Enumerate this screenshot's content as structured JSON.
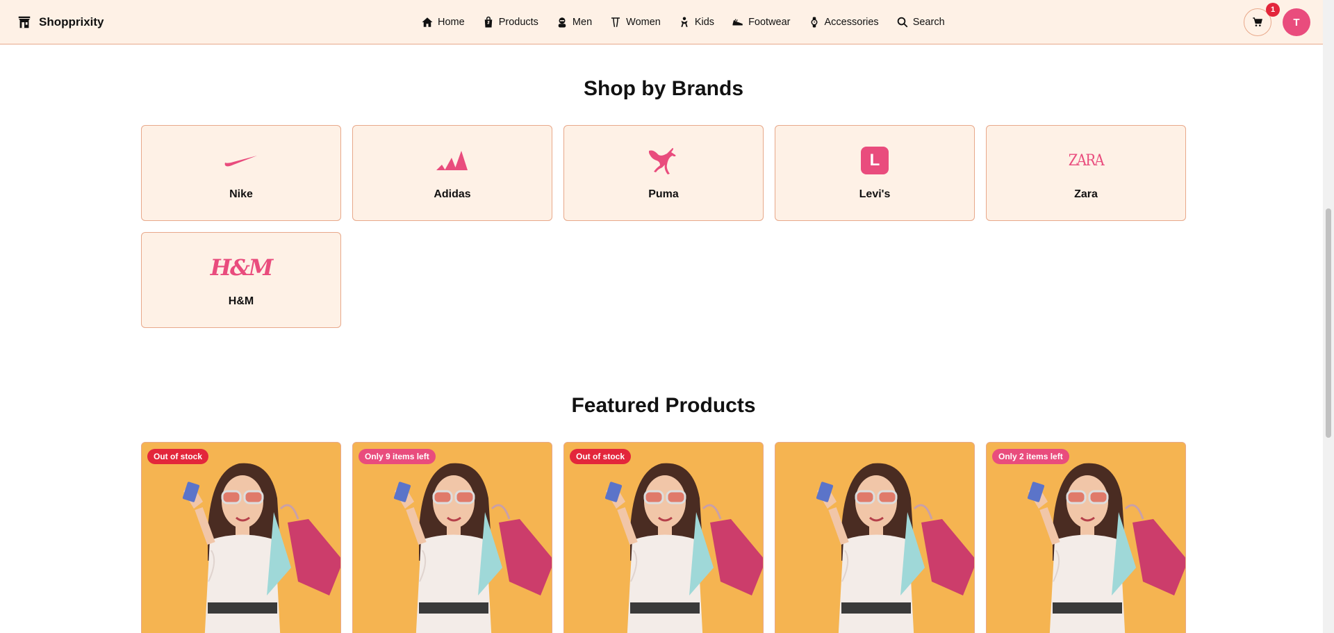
{
  "app": {
    "name": "Shopprixity"
  },
  "nav": {
    "links": [
      {
        "label": "Home",
        "icon": "home-icon"
      },
      {
        "label": "Products",
        "icon": "shopping-bag-icon"
      },
      {
        "label": "Men",
        "icon": "men-icon"
      },
      {
        "label": "Women",
        "icon": "women-icon"
      },
      {
        "label": "Kids",
        "icon": "kids-icon"
      },
      {
        "label": "Footwear",
        "icon": "shoe-icon"
      },
      {
        "label": "Accessories",
        "icon": "watch-icon"
      },
      {
        "label": "Search",
        "icon": "search-icon"
      }
    ]
  },
  "cart": {
    "count": "1",
    "icon": "cart-icon"
  },
  "user": {
    "initial": "T"
  },
  "brands_section": {
    "title": "Shop by Brands",
    "brands": [
      {
        "name": "Nike"
      },
      {
        "name": "Adidas"
      },
      {
        "name": "Puma"
      },
      {
        "name": "Levi's",
        "logo_text": "L"
      },
      {
        "name": "Zara",
        "logo_text": "ZARA"
      },
      {
        "name": "H&M",
        "logo_text": "H&M"
      }
    ]
  },
  "featured_section": {
    "title": "Featured Products",
    "products": [
      {
        "badge": "Out of stock",
        "badge_type": "out"
      },
      {
        "badge": "Only 9 items left",
        "badge_type": "low"
      },
      {
        "badge": "Out of stock",
        "badge_type": "out"
      },
      {
        "badge": "",
        "badge_type": "none"
      },
      {
        "badge": "Only 2 items left",
        "badge_type": "low"
      }
    ]
  },
  "colors": {
    "accent": "#e94c7d",
    "nav_bg": "#fef1e6",
    "border": "#e8a88a",
    "product_bg": "#f5b451",
    "badge_red": "#e3263b"
  }
}
